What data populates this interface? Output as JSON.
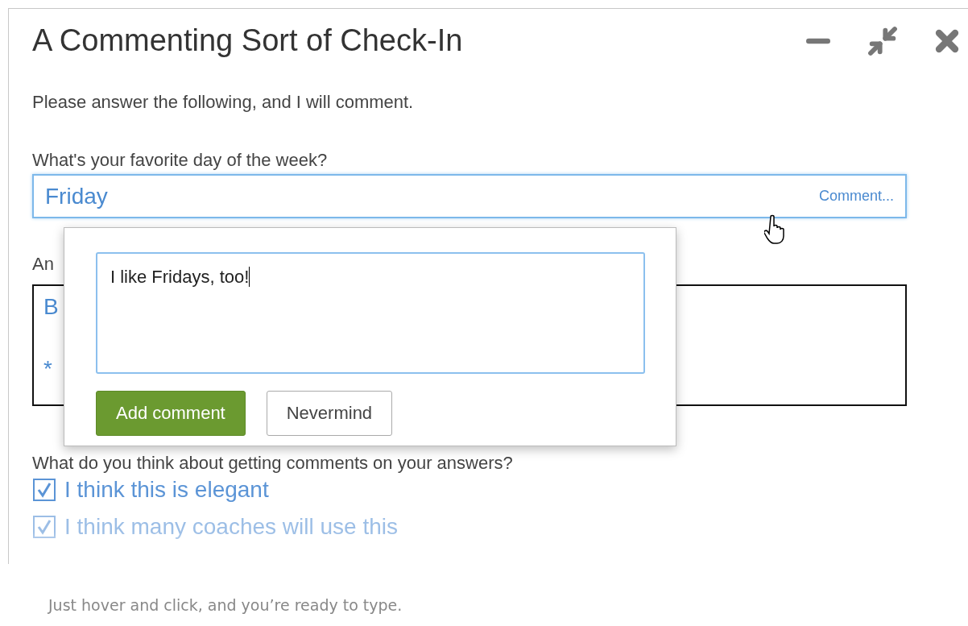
{
  "window": {
    "title": "A Commenting Sort of Check-In"
  },
  "intro": "Please answer the following, and I will comment.",
  "questions": [
    {
      "kind": "field",
      "label": "What's your favorite day of the week?",
      "value": "Friday",
      "comment_link": "Comment..."
    },
    {
      "kind": "textarea",
      "label": "An",
      "lines": [
        "B",
        "*"
      ]
    },
    {
      "kind": "checks",
      "label": "What do you think about getting comments on your answers?",
      "options": [
        {
          "label": "I think this is elegant",
          "checked": true,
          "faded": false
        },
        {
          "label": "I think many coaches will use this",
          "checked": true,
          "faded": true
        }
      ]
    }
  ],
  "comment_popup": {
    "text": "I like Fridays, too!",
    "buttons": [
      {
        "label": "Add comment",
        "kind": "primary"
      },
      {
        "label": "Nevermind",
        "kind": "secondary"
      }
    ]
  },
  "caption": "Just hover and click, and you’re ready to type."
}
